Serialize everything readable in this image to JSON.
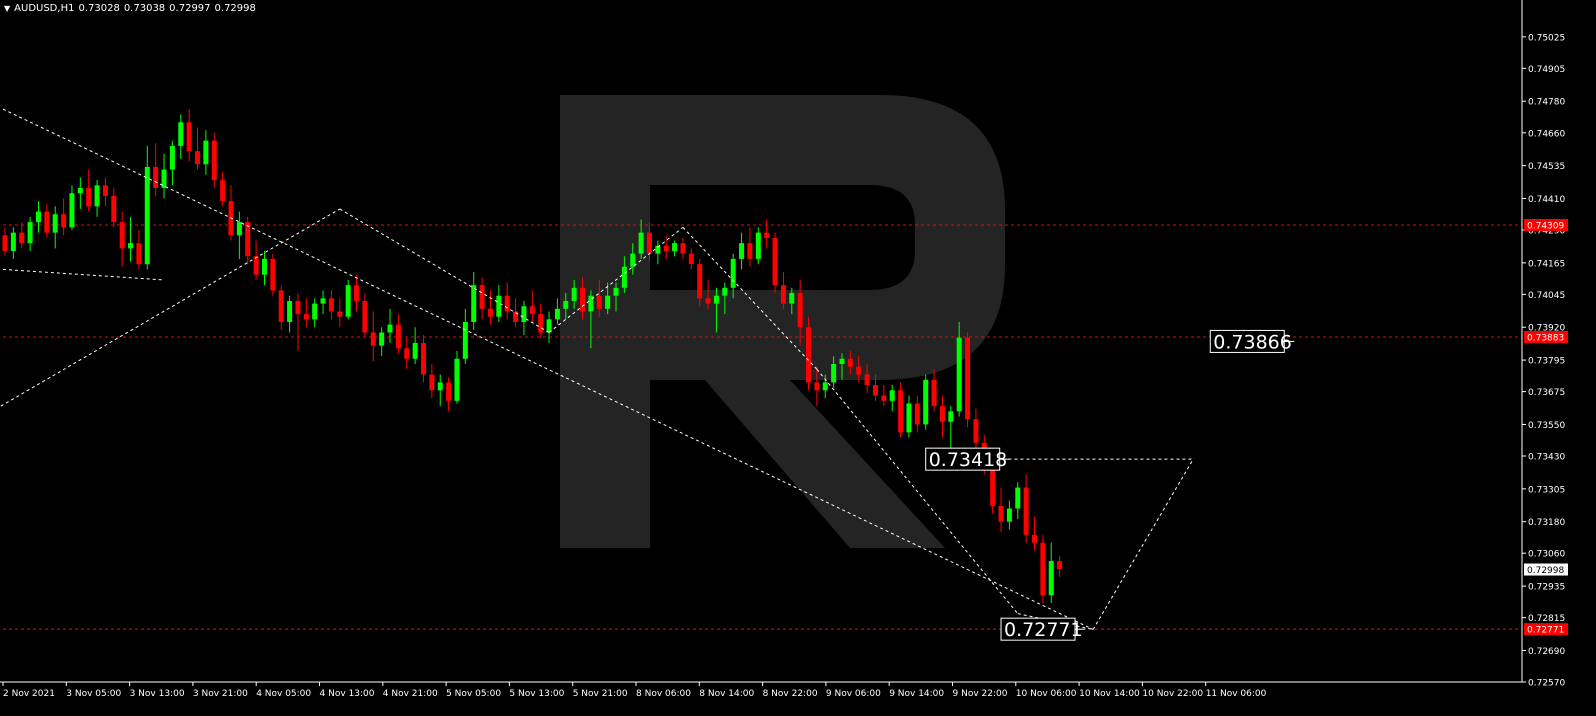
{
  "header": {
    "symbol_timeframe": "AUDUSD,H1",
    "open": "0.73028",
    "high": "0.73038",
    "low": "0.72997",
    "close": "0.72998"
  },
  "colors": {
    "background": "#000000",
    "bull_candle": "#00ff00",
    "bear_candle": "#ff0000",
    "level_line": "#ff0000",
    "forecast_line": "#ffffff",
    "axis": "#ffffff",
    "watermark": "#242424"
  },
  "watermark_icon": "broker-logo-icon",
  "chart_data": {
    "type": "candlestick",
    "symbol": "AUDUSD",
    "timeframe": "H1",
    "y_ticks": [
      "0.75025",
      "0.74905",
      "0.74780",
      "0.74660",
      "0.74535",
      "0.74410",
      "0.74290",
      "0.74165",
      "0.74045",
      "0.73920",
      "0.73795",
      "0.73675",
      "0.73550",
      "0.73430",
      "0.73305",
      "0.73180",
      "0.73060",
      "0.72935",
      "0.72815",
      "0.72690",
      "0.72570"
    ],
    "ylim": [
      0.7257,
      0.7515
    ],
    "x_ticks": [
      "2 Nov 2021",
      "3 Nov 05:00",
      "3 Nov 13:00",
      "3 Nov 21:00",
      "4 Nov 05:00",
      "4 Nov 13:00",
      "4 Nov 21:00",
      "5 Nov 05:00",
      "5 Nov 13:00",
      "5 Nov 21:00",
      "8 Nov 06:00",
      "8 Nov 14:00",
      "8 Nov 22:00",
      "9 Nov 06:00",
      "9 Nov 14:00",
      "9 Nov 22:00",
      "10 Nov 06:00",
      "10 Nov 14:00",
      "10 Nov 22:00",
      "11 Nov 06:00"
    ],
    "axis_price_tags": [
      {
        "value": "0.74309",
        "kind": "level"
      },
      {
        "value": "0.73883",
        "kind": "level"
      },
      {
        "value": "0.72998",
        "kind": "current"
      },
      {
        "value": "0.72771",
        "kind": "level"
      }
    ],
    "levels": [
      {
        "value": 0.74309,
        "label": ""
      },
      {
        "value": 0.73883,
        "label": "0.73866"
      },
      {
        "value": 0.73418,
        "label": "0.73418"
      },
      {
        "value": 0.72771,
        "label": "0.72771"
      }
    ],
    "current_price": 0.72998,
    "candles": [
      [
        0.7427,
        0.743,
        0.7419,
        0.7421
      ],
      [
        0.7421,
        0.743,
        0.7418,
        0.7428
      ],
      [
        0.7428,
        0.7432,
        0.7422,
        0.7424
      ],
      [
        0.7424,
        0.7434,
        0.7421,
        0.7432
      ],
      [
        0.7432,
        0.744,
        0.7428,
        0.7436
      ],
      [
        0.7436,
        0.7439,
        0.7426,
        0.7428
      ],
      [
        0.7428,
        0.7438,
        0.7422,
        0.7435
      ],
      [
        0.7435,
        0.7441,
        0.7427,
        0.743
      ],
      [
        0.743,
        0.7446,
        0.7429,
        0.7443
      ],
      [
        0.7443,
        0.7449,
        0.7437,
        0.7445
      ],
      [
        0.7445,
        0.7452,
        0.7436,
        0.7438
      ],
      [
        0.7438,
        0.7448,
        0.7434,
        0.7446
      ],
      [
        0.7446,
        0.7449,
        0.7438,
        0.7442
      ],
      [
        0.7442,
        0.7445,
        0.743,
        0.7432
      ],
      [
        0.7432,
        0.7436,
        0.7415,
        0.7422
      ],
      [
        0.7422,
        0.7434,
        0.7417,
        0.7424
      ],
      [
        0.7424,
        0.7429,
        0.7414,
        0.7416
      ],
      [
        0.7416,
        0.7461,
        0.7414,
        0.7453
      ],
      [
        0.7453,
        0.7462,
        0.7442,
        0.7445
      ],
      [
        0.7445,
        0.7458,
        0.7441,
        0.7452
      ],
      [
        0.7452,
        0.7463,
        0.7446,
        0.7461
      ],
      [
        0.7461,
        0.7473,
        0.7456,
        0.747
      ],
      [
        0.747,
        0.7475,
        0.7455,
        0.7459
      ],
      [
        0.7459,
        0.7468,
        0.7452,
        0.7454
      ],
      [
        0.7454,
        0.7467,
        0.745,
        0.7463
      ],
      [
        0.7463,
        0.7466,
        0.7445,
        0.7448
      ],
      [
        0.7448,
        0.7451,
        0.7438,
        0.744
      ],
      [
        0.744,
        0.7446,
        0.7425,
        0.7427
      ],
      [
        0.7427,
        0.7436,
        0.7418,
        0.7432
      ],
      [
        0.7432,
        0.7434,
        0.7416,
        0.7419
      ],
      [
        0.7419,
        0.7425,
        0.741,
        0.7412
      ],
      [
        0.7412,
        0.7421,
        0.7408,
        0.7418
      ],
      [
        0.7418,
        0.742,
        0.7404,
        0.7406
      ],
      [
        0.7406,
        0.7408,
        0.7391,
        0.7394
      ],
      [
        0.7394,
        0.7404,
        0.739,
        0.7402
      ],
      [
        0.7402,
        0.7405,
        0.7383,
        0.7397
      ],
      [
        0.7397,
        0.7403,
        0.7392,
        0.7395
      ],
      [
        0.7395,
        0.7403,
        0.7392,
        0.7401
      ],
      [
        0.7401,
        0.7406,
        0.7397,
        0.7403
      ],
      [
        0.7403,
        0.7406,
        0.7395,
        0.7398
      ],
      [
        0.7398,
        0.7403,
        0.7392,
        0.7396
      ],
      [
        0.7396,
        0.741,
        0.7395,
        0.7408
      ],
      [
        0.7408,
        0.7412,
        0.7398,
        0.7402
      ],
      [
        0.7402,
        0.7405,
        0.7388,
        0.739
      ],
      [
        0.739,
        0.7398,
        0.7379,
        0.7385
      ],
      [
        0.7385,
        0.7392,
        0.7381,
        0.739
      ],
      [
        0.739,
        0.7399,
        0.7386,
        0.7393
      ],
      [
        0.7393,
        0.7397,
        0.7382,
        0.7384
      ],
      [
        0.7384,
        0.7388,
        0.7376,
        0.738
      ],
      [
        0.738,
        0.7392,
        0.7378,
        0.7386
      ],
      [
        0.7386,
        0.7389,
        0.7371,
        0.7374
      ],
      [
        0.7374,
        0.7378,
        0.7365,
        0.7368
      ],
      [
        0.7368,
        0.7374,
        0.7362,
        0.7371
      ],
      [
        0.7371,
        0.7373,
        0.736,
        0.7364
      ],
      [
        0.7364,
        0.7383,
        0.7363,
        0.738
      ],
      [
        0.738,
        0.7399,
        0.7378,
        0.7394
      ],
      [
        0.7394,
        0.7413,
        0.7391,
        0.7408
      ],
      [
        0.7408,
        0.7411,
        0.7395,
        0.7399
      ],
      [
        0.7399,
        0.7406,
        0.7393,
        0.7396
      ],
      [
        0.7396,
        0.7408,
        0.7394,
        0.7404
      ],
      [
        0.7404,
        0.7409,
        0.7395,
        0.7398
      ],
      [
        0.7398,
        0.7403,
        0.7392,
        0.7394
      ],
      [
        0.7394,
        0.7402,
        0.7389,
        0.74
      ],
      [
        0.74,
        0.7406,
        0.7394,
        0.7397
      ],
      [
        0.7397,
        0.7401,
        0.7388,
        0.739
      ],
      [
        0.739,
        0.7398,
        0.7386,
        0.7395
      ],
      [
        0.7395,
        0.7403,
        0.7393,
        0.7399
      ],
      [
        0.7399,
        0.7405,
        0.7395,
        0.7402
      ],
      [
        0.7402,
        0.741,
        0.7399,
        0.7407
      ],
      [
        0.7407,
        0.7411,
        0.7395,
        0.7398
      ],
      [
        0.7398,
        0.7406,
        0.7384,
        0.7404
      ],
      [
        0.7404,
        0.741,
        0.7396,
        0.7399
      ],
      [
        0.7399,
        0.7409,
        0.7397,
        0.7404
      ],
      [
        0.7404,
        0.7409,
        0.7398,
        0.7407
      ],
      [
        0.7407,
        0.7419,
        0.7405,
        0.7415
      ],
      [
        0.7415,
        0.7424,
        0.7412,
        0.742
      ],
      [
        0.742,
        0.7433,
        0.7418,
        0.7428
      ],
      [
        0.7428,
        0.7432,
        0.7417,
        0.742
      ],
      [
        0.742,
        0.7425,
        0.7416,
        0.7423
      ],
      [
        0.7423,
        0.7427,
        0.7418,
        0.7421
      ],
      [
        0.7421,
        0.7425,
        0.7419,
        0.7424
      ],
      [
        0.7424,
        0.7426,
        0.7418,
        0.742
      ],
      [
        0.742,
        0.7422,
        0.7414,
        0.7416
      ],
      [
        0.7416,
        0.7418,
        0.74,
        0.7403
      ],
      [
        0.7403,
        0.741,
        0.7399,
        0.7401
      ],
      [
        0.7401,
        0.7407,
        0.739,
        0.7404
      ],
      [
        0.7404,
        0.7409,
        0.7397,
        0.7407
      ],
      [
        0.7407,
        0.742,
        0.7403,
        0.7418
      ],
      [
        0.7418,
        0.7428,
        0.7414,
        0.7424
      ],
      [
        0.7424,
        0.743,
        0.7415,
        0.7418
      ],
      [
        0.7418,
        0.743,
        0.7416,
        0.7428
      ],
      [
        0.7428,
        0.7433,
        0.7422,
        0.7426
      ],
      [
        0.7426,
        0.7428,
        0.7405,
        0.7408
      ],
      [
        0.7408,
        0.7413,
        0.7399,
        0.7401
      ],
      [
        0.7401,
        0.7407,
        0.7397,
        0.7405
      ],
      [
        0.7405,
        0.741,
        0.7385,
        0.7392
      ],
      [
        0.7392,
        0.7396,
        0.7368,
        0.7371
      ],
      [
        0.7371,
        0.7377,
        0.7362,
        0.7368
      ],
      [
        0.7368,
        0.7374,
        0.7365,
        0.7371
      ],
      [
        0.7371,
        0.7381,
        0.7369,
        0.7378
      ],
      [
        0.7378,
        0.7382,
        0.7372,
        0.738
      ],
      [
        0.738,
        0.7383,
        0.7374,
        0.7377
      ],
      [
        0.7377,
        0.7381,
        0.7371,
        0.7374
      ],
      [
        0.7374,
        0.7378,
        0.7367,
        0.737
      ],
      [
        0.737,
        0.7374,
        0.7364,
        0.7366
      ],
      [
        0.7366,
        0.737,
        0.7362,
        0.7364
      ],
      [
        0.7364,
        0.737,
        0.736,
        0.7368
      ],
      [
        0.7368,
        0.7371,
        0.735,
        0.7352
      ],
      [
        0.7352,
        0.7366,
        0.735,
        0.7363
      ],
      [
        0.7363,
        0.7366,
        0.7352,
        0.7355
      ],
      [
        0.7355,
        0.7374,
        0.7353,
        0.7372
      ],
      [
        0.7372,
        0.7376,
        0.736,
        0.7362
      ],
      [
        0.7362,
        0.7366,
        0.735,
        0.7356
      ],
      [
        0.7356,
        0.7362,
        0.7341,
        0.736
      ],
      [
        0.736,
        0.7394,
        0.7358,
        0.7388
      ],
      [
        0.7388,
        0.739,
        0.7354,
        0.7357
      ],
      [
        0.7357,
        0.7361,
        0.7344,
        0.7348
      ],
      [
        0.7348,
        0.7351,
        0.7336,
        0.734
      ],
      [
        0.734,
        0.7345,
        0.7321,
        0.7324
      ],
      [
        0.7324,
        0.7331,
        0.7314,
        0.7318
      ],
      [
        0.7318,
        0.7326,
        0.7315,
        0.7323
      ],
      [
        0.7323,
        0.7333,
        0.7319,
        0.7331
      ],
      [
        0.7331,
        0.7336,
        0.731,
        0.7313
      ],
      [
        0.7313,
        0.732,
        0.7307,
        0.731
      ],
      [
        0.731,
        0.7313,
        0.7287,
        0.729
      ],
      [
        0.729,
        0.731,
        0.7287,
        0.7303
      ],
      [
        0.7303,
        0.7305,
        0.7297,
        0.73
      ]
    ],
    "forecast_path": [
      {
        "x": "candle",
        "i": -0.5,
        "y": 0.7362
      },
      {
        "x": "candle",
        "i": 40,
        "y": 0.7437
      },
      {
        "x": "candle",
        "i": 65,
        "y": 0.739
      },
      {
        "x": "candle",
        "i": 81,
        "y": 0.743
      },
      {
        "x": "candle",
        "i": 97,
        "y": 0.7376
      },
      {
        "x": "candle",
        "i": 121,
        "y": 0.7283
      },
      {
        "x": "candle",
        "i": 130,
        "y": 0.7277
      },
      {
        "x": "candle",
        "i": 142,
        "y": 0.7342
      }
    ]
  }
}
